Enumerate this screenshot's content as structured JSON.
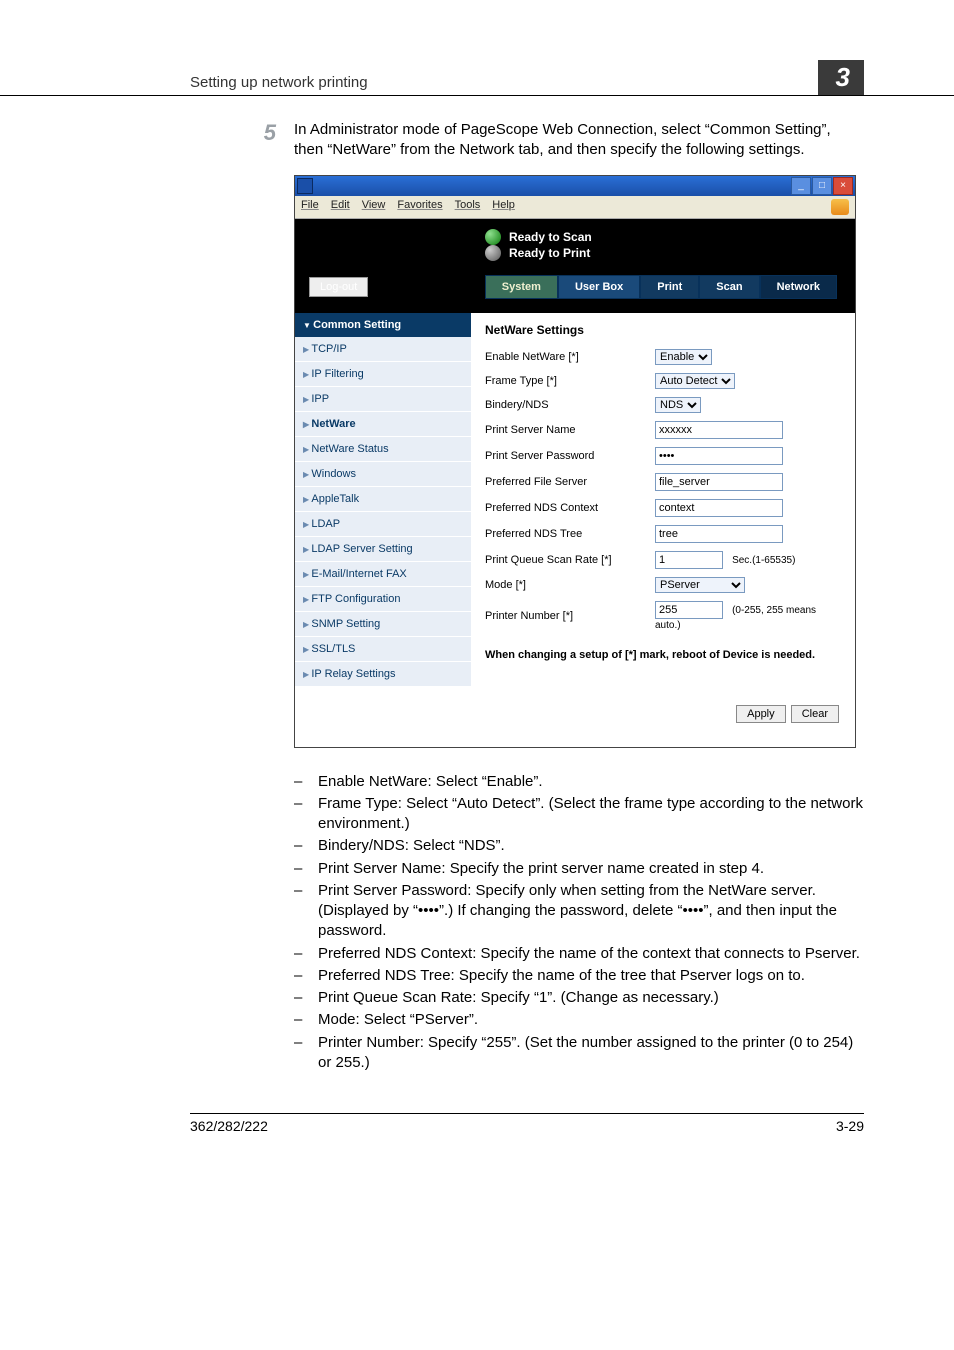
{
  "header": {
    "running_title": "Setting up network printing",
    "chapter_num": "3"
  },
  "step": {
    "num": "5",
    "text": "In Administrator mode of PageScope Web Connection, select “Common Setting”, then “NetWare” from the Network tab, and then specify the following settings."
  },
  "window": {
    "menu": {
      "file": "File",
      "edit": "Edit",
      "view": "View",
      "favorites": "Favorites",
      "tools": "Tools",
      "help": "Help"
    },
    "btn_min": "_",
    "btn_max": "□",
    "btn_close": "×"
  },
  "status": {
    "scan": "Ready to Scan",
    "print": "Ready to Print"
  },
  "logout": "Log-out",
  "tabs": {
    "system": "System",
    "userbox": "User Box",
    "print": "Print",
    "scan": "Scan",
    "network": "Network"
  },
  "sidebar": {
    "header": "Common Setting",
    "items": [
      "TCP/IP",
      "IP Filtering",
      "IPP",
      "NetWare",
      "NetWare Status",
      "Windows",
      "AppleTalk",
      "LDAP",
      "LDAP Server Setting",
      "E-Mail/Internet FAX",
      "FTP Configuration",
      "SNMP Setting",
      "SSL/TLS",
      "IP Relay Settings"
    ]
  },
  "panel": {
    "title": "NetWare Settings",
    "labels": {
      "enable": "Enable NetWare [*]",
      "frame": "Frame Type [*]",
      "bindery": "Bindery/NDS",
      "psname": "Print Server Name",
      "pspass": "Print Server Password",
      "preffs": "Preferred File Server",
      "ndsctx": "Preferred NDS Context",
      "ndstree": "Preferred NDS Tree",
      "scanrate": "Print Queue Scan Rate [*]",
      "mode": "Mode [*]",
      "prnum": "Printer Number [*]"
    },
    "values": {
      "enable": "Enable",
      "frame": "Auto Detect",
      "bindery": "NDS",
      "psname": "xxxxxx",
      "pspass": "••••",
      "preffs": "file_server",
      "ndsctx": "context",
      "ndstree": "tree",
      "scanrate": "1",
      "scanrate_hint": "Sec.(1-65535)",
      "mode": "PServer",
      "prnum": "255",
      "prnum_hint": "(0-255, 255 means auto.)"
    },
    "note": "When changing a setup of [*] mark, reboot of Device is needed.",
    "apply": "Apply",
    "clear": "Clear"
  },
  "bullets": [
    "Enable NetWare: Select “Enable”.",
    "Frame Type: Select “Auto Detect”. (Select the frame type according to the network environment.)",
    "Bindery/NDS: Select “NDS”.",
    "Print Server Name: Specify the print server name created in step 4.",
    "Print Server Password: Specify only when setting from the NetWare server. (Displayed by “••••”.) If changing the password, delete “••••”, and then input the password.",
    "Preferred NDS Context: Specify the name of the context that connects to Pserver.",
    "Preferred NDS Tree: Specify the name of the tree that Pserver logs on to.",
    "Print Queue Scan Rate: Specify “1”. (Change as necessary.)",
    "Mode: Select “PServer”.",
    "Printer Number: Specify “255”. (Set the number assigned to the printer (0 to 254) or 255.)"
  ],
  "footer": {
    "left": "362/282/222",
    "right": "3-29"
  }
}
